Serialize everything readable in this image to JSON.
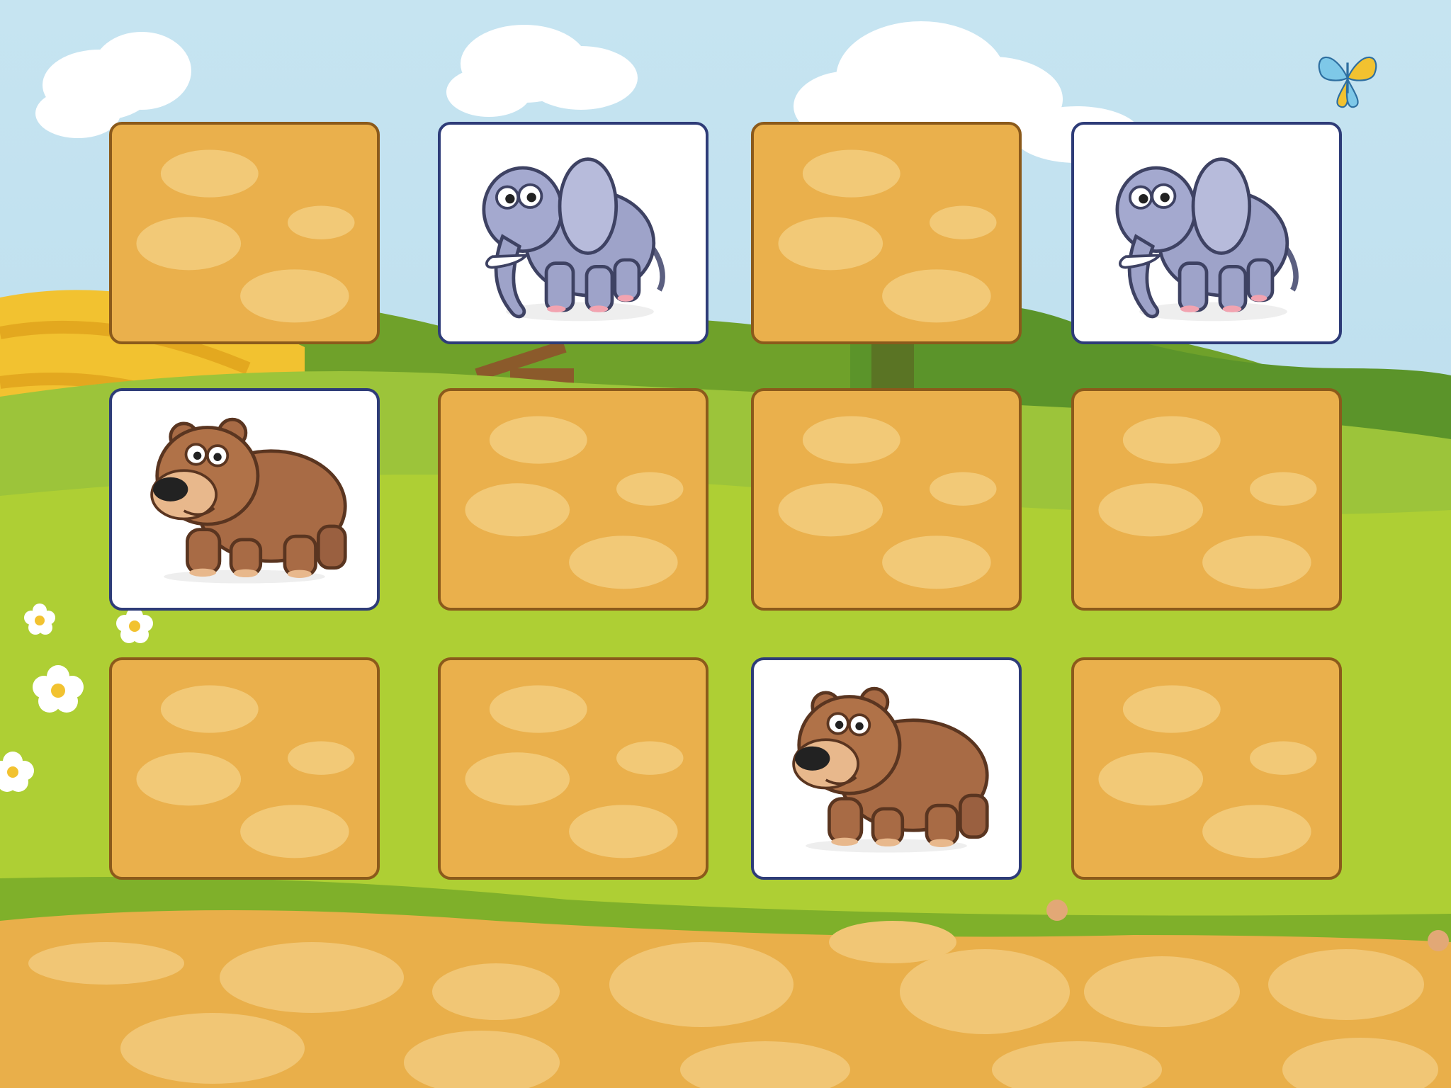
{
  "game": {
    "name": "",
    "board": {
      "rows": 3,
      "columns": 4
    },
    "cards": [
      {
        "row": 0,
        "col": 0,
        "state": "face-down",
        "animal": null
      },
      {
        "row": 0,
        "col": 1,
        "state": "face-up",
        "animal": "elephant"
      },
      {
        "row": 0,
        "col": 2,
        "state": "face-down",
        "animal": null
      },
      {
        "row": 0,
        "col": 3,
        "state": "face-up",
        "animal": "elephant"
      },
      {
        "row": 1,
        "col": 0,
        "state": "face-up",
        "animal": "bear"
      },
      {
        "row": 1,
        "col": 1,
        "state": "face-down",
        "animal": null
      },
      {
        "row": 1,
        "col": 2,
        "state": "face-down",
        "animal": null
      },
      {
        "row": 1,
        "col": 3,
        "state": "face-down",
        "animal": null
      },
      {
        "row": 2,
        "col": 0,
        "state": "face-down",
        "animal": null
      },
      {
        "row": 2,
        "col": 1,
        "state": "face-down",
        "animal": null
      },
      {
        "row": 2,
        "col": 2,
        "state": "face-up",
        "animal": "bear"
      },
      {
        "row": 2,
        "col": 3,
        "state": "face-down",
        "animal": null
      }
    ]
  },
  "icons": {
    "card_back": "stone-pattern-card-back",
    "elephant": "elephant-icon",
    "bear": "bear-icon",
    "butterfly": "butterfly-icon",
    "flower": "daisy-flower-icon"
  },
  "colors": {
    "sky": "#BFE0EE",
    "card_back": "#EAB04C",
    "card_back_stone": "#F2C977",
    "card_back_border": "#8B5A1B",
    "card_face": "#FFFFFF",
    "card_face_border": "#2E3C78",
    "grass": "#A9CD32",
    "path": "#E9AF4A"
  }
}
